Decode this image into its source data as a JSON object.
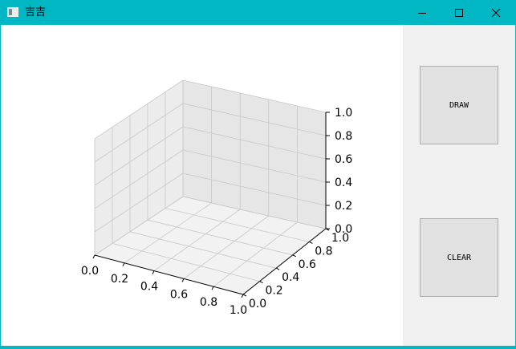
{
  "window": {
    "title": "吉吉",
    "minimize_icon": "minimize-icon",
    "maximize_icon": "maximize-icon",
    "close_icon": "close-icon"
  },
  "buttons": {
    "draw_label": "DRAW",
    "clear_label": "CLEAR"
  },
  "chart_data": {
    "type": "3d-axes",
    "title": "",
    "x_ticks": [
      "0.0",
      "0.2",
      "0.4",
      "0.6",
      "0.8",
      "1.0"
    ],
    "y_ticks": [
      "0.0",
      "0.2",
      "0.4",
      "0.6",
      "0.8",
      "1.0"
    ],
    "z_ticks": [
      "0.0",
      "0.2",
      "0.4",
      "0.6",
      "0.8",
      "1.0"
    ],
    "xlim": [
      0,
      1
    ],
    "ylim": [
      0,
      1
    ],
    "zlim": [
      0,
      1
    ],
    "grid": true,
    "series": []
  }
}
